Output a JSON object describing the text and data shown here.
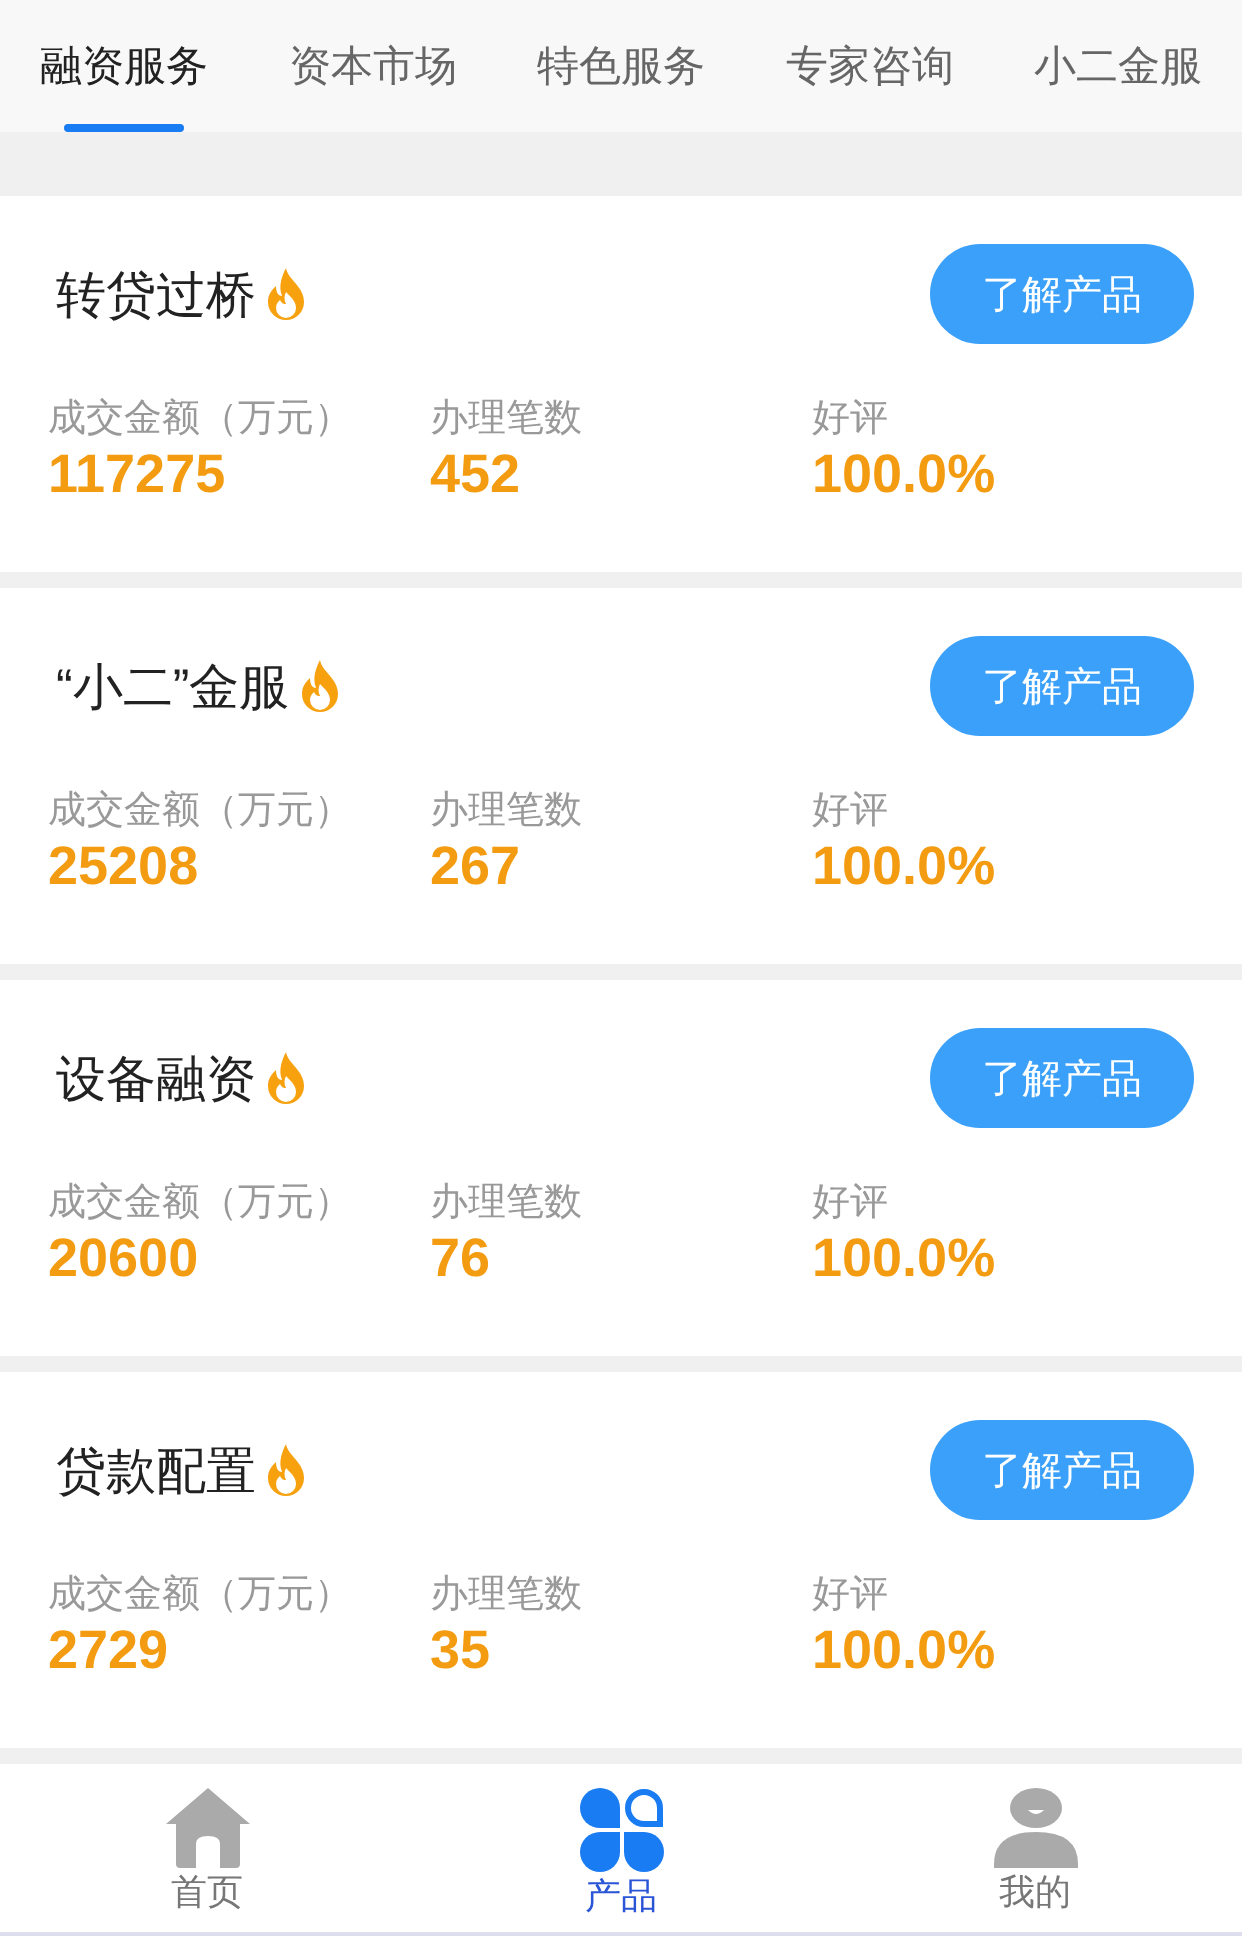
{
  "tabs": [
    {
      "label": "融资服务",
      "selected": true
    },
    {
      "label": "资本市场",
      "selected": false
    },
    {
      "label": "特色服务",
      "selected": false
    },
    {
      "label": "专家咨询",
      "selected": false
    },
    {
      "label": "小二金服",
      "selected": false
    }
  ],
  "products": [
    {
      "name": "转贷过桥",
      "hot": true,
      "button": "了解产品",
      "stats": [
        {
          "label": "成交金额（万元）",
          "value": "117275"
        },
        {
          "label": "办理笔数",
          "value": "452"
        },
        {
          "label": "好评",
          "value": "100.0%"
        }
      ]
    },
    {
      "name": "“小二”金服",
      "hot": true,
      "button": "了解产品",
      "stats": [
        {
          "label": "成交金额（万元）",
          "value": "25208"
        },
        {
          "label": "办理笔数",
          "value": "267"
        },
        {
          "label": "好评",
          "value": "100.0%"
        }
      ]
    },
    {
      "name": "设备融资",
      "hot": true,
      "button": "了解产品",
      "stats": [
        {
          "label": "成交金额（万元）",
          "value": "20600"
        },
        {
          "label": "办理笔数",
          "value": "76"
        },
        {
          "label": "好评",
          "value": "100.0%"
        }
      ]
    },
    {
      "name": "贷款配置",
      "hot": true,
      "button": "了解产品",
      "stats": [
        {
          "label": "成交金额（万元）",
          "value": "2729"
        },
        {
          "label": "办理笔数",
          "value": "35"
        },
        {
          "label": "好评",
          "value": "100.0%"
        }
      ]
    }
  ],
  "bottom_nav": [
    {
      "kind": "home",
      "label": "首页",
      "selected": false
    },
    {
      "kind": "products",
      "label": "产品",
      "selected": true
    },
    {
      "kind": "profile",
      "label": "我的",
      "selected": false
    }
  ]
}
